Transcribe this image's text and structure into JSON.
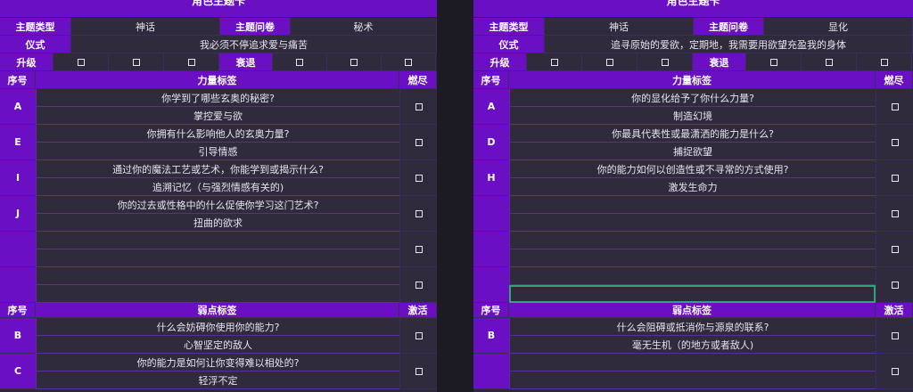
{
  "labels": {
    "sheet_title": "角色主题卡",
    "theme_type": "主题类型",
    "theme_book": "主题问卷",
    "ritual": "仪式",
    "upgrade": "升级",
    "decay": "衰退",
    "seq": "序号",
    "power_tags": "力量标签",
    "burn": "燃尽",
    "weakness_tags": "弱点标签",
    "activate": "激活"
  },
  "left": {
    "theme_type": "神话",
    "theme_book": "秘术",
    "ritual": "我必须不停追求爱与痛苦",
    "power_tags": [
      {
        "letter": "A",
        "question": "你学到了哪些玄奥的秘密?",
        "answer": "掌控爱与欲"
      },
      {
        "letter": "E",
        "question": "你拥有什么影响他人的玄奥力量?",
        "answer": "引导情感"
      },
      {
        "letter": "I",
        "question": "通过你的魔法工艺或艺术，你能学到或揭示什么?",
        "answer": "追溯记忆（与强烈情感有关的)"
      },
      {
        "letter": "J",
        "question": "你的过去或性格中的什么促使你学习这门艺术?",
        "answer": "扭曲的欲求"
      },
      {
        "letter": "",
        "question": "",
        "answer": ""
      },
      {
        "letter": "",
        "question": "",
        "answer": ""
      }
    ],
    "weakness_tags": [
      {
        "letter": "B",
        "question": "什么会妨碍你使用你的能力?",
        "answer": "心智坚定的敌人"
      },
      {
        "letter": "C",
        "question": "你的能力是如何让你变得难以相处的?",
        "answer": "轻浮不定"
      }
    ]
  },
  "right": {
    "theme_type": "神话",
    "theme_book": "显化",
    "ritual": "追寻原始的爱欲，定期地，我需要用欲望充盈我的身体",
    "power_tags": [
      {
        "letter": "A",
        "question": "你的显化给予了你什么力量?",
        "answer": "制造幻境"
      },
      {
        "letter": "D",
        "question": "你最具代表性或最潇洒的能力是什么?",
        "answer": "捕捉欲望"
      },
      {
        "letter": "H",
        "question": "你的能力如何以创造性或不寻常的方式使用?",
        "answer": "激发生命力"
      },
      {
        "letter": "",
        "question": "",
        "answer": ""
      },
      {
        "letter": "",
        "question": "",
        "answer": ""
      },
      {
        "letter": "",
        "question": "",
        "answer": ""
      }
    ],
    "weakness_tags": [
      {
        "letter": "B",
        "question": "什么会阻碍或抵消你与源泉的联系?",
        "answer": "毫无生机（的地方或者敌人)"
      },
      {
        "letter": "",
        "question": "",
        "answer": ""
      }
    ]
  },
  "icons": {
    "checkbox": "checkbox-icon"
  },
  "colors": {
    "header_purple": "#6b0fc4",
    "cell_dark": "#2f2b3d",
    "selection_green": "#2fa37a"
  }
}
